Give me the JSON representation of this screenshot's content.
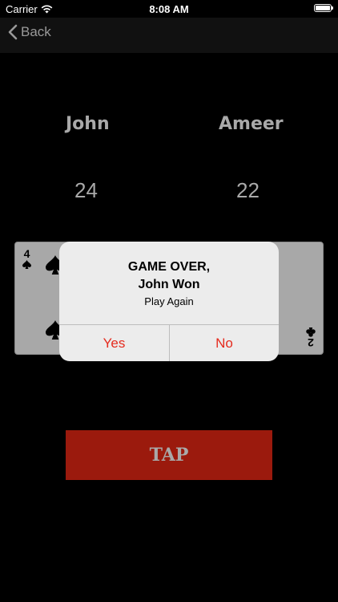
{
  "status_bar": {
    "carrier": "Carrier",
    "time": "8:08 AM"
  },
  "nav": {
    "back_label": "Back"
  },
  "players": [
    {
      "name": "John",
      "score": "24"
    },
    {
      "name": "Ameer",
      "score": "22"
    }
  ],
  "cards": {
    "left": {
      "rank": "4",
      "suit": "spade"
    },
    "right": {
      "rank": "2",
      "suit": "club"
    }
  },
  "alert": {
    "title_line1": "GAME OVER,",
    "title_line2": "John Won",
    "message": "Play Again",
    "yes_label": "Yes",
    "no_label": "No"
  },
  "tap_button": {
    "label": "TAP"
  },
  "colors": {
    "background": "#000000",
    "accent": "#e52b1e",
    "tap_button": "#9b1a0d",
    "text_gray": "#a9a9a9"
  }
}
